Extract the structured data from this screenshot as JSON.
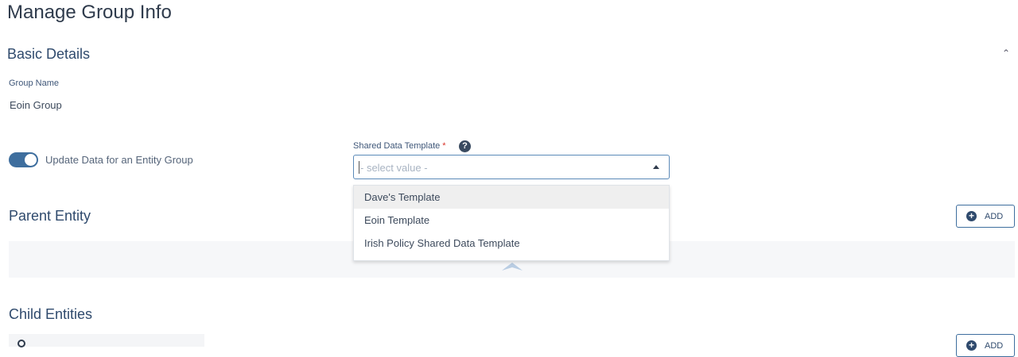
{
  "page": {
    "title": "Manage Group Info"
  },
  "basic_details": {
    "title": "Basic Details",
    "group_name_label": "Group Name",
    "group_name_value": "Eoin Group"
  },
  "entity_toggle": {
    "label": "Update Data for an Entity Group",
    "enabled": true
  },
  "shared_data_template": {
    "label": "Shared Data Template",
    "required_mark": "*",
    "help": "?",
    "placeholder": "- select value -",
    "options": [
      "Dave's Template",
      "Eoin Template",
      "Irish Policy Shared Data Template"
    ],
    "highlighted_option": 0
  },
  "parent_entity": {
    "title": "Parent Entity",
    "add_label": "ADD"
  },
  "child_entities": {
    "title": "Child Entities",
    "add_label": "ADD"
  },
  "icons": {
    "collapse": "chevron-up-icon",
    "help": "question-circle-icon",
    "add": "plus-circle-icon",
    "search": "search-icon",
    "dropdown": "caret-up-icon"
  },
  "colors": {
    "accent": "#3e6e9e",
    "required": "#d9342b"
  }
}
